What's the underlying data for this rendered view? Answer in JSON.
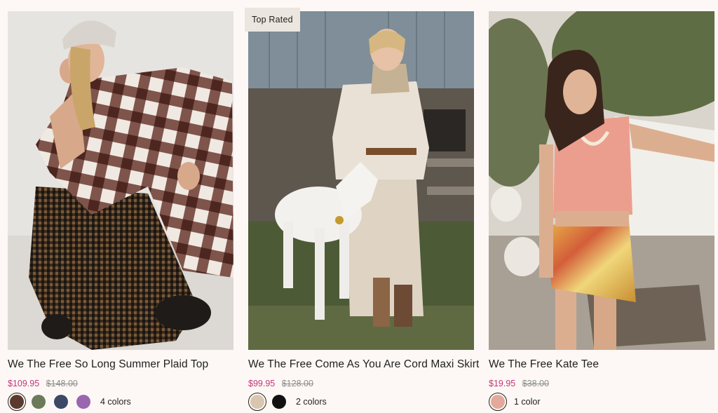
{
  "products": [
    {
      "title": "We The Free So Long Summer Plaid Top",
      "sale_price": "$109.95",
      "original_price": "$148.00",
      "colors_label": "4 colors",
      "badge": "",
      "swatches": [
        "#5a3a2c",
        "#6d7a5a",
        "#3c4866",
        "#9a66b0"
      ],
      "image_alt": "Model wearing brown plaid shirt"
    },
    {
      "title": "We The Free Come As You Are Cord Maxi Skirt",
      "sale_price": "$99.95",
      "original_price": "$128.00",
      "colors_label": "2 colors",
      "badge": "Top Rated",
      "swatches": [
        "#d8c7ae",
        "#111111"
      ],
      "image_alt": "Model in cream cord maxi skirt with goat"
    },
    {
      "title": "We The Free Kate Tee",
      "sale_price": "$19.95",
      "original_price": "$38.00",
      "colors_label": "1 color",
      "badge": "",
      "swatches": [
        "#e3a99a"
      ],
      "image_alt": "Model in pink tank top"
    }
  ]
}
